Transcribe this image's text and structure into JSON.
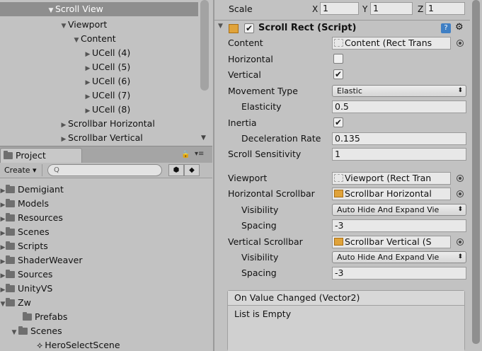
{
  "hierarchy": {
    "rows": [
      {
        "label": "Scroll View",
        "arrow": "▼",
        "selected": true
      },
      {
        "label": "Viewport",
        "arrow": "▼"
      },
      {
        "label": "Content",
        "arrow": "▼"
      },
      {
        "label": "UCell (4)",
        "arrow": "▶"
      },
      {
        "label": "UCell (5)",
        "arrow": "▶"
      },
      {
        "label": "UCell (6)",
        "arrow": "▶"
      },
      {
        "label": "UCell (7)",
        "arrow": "▶"
      },
      {
        "label": "UCell (8)",
        "arrow": "▶"
      },
      {
        "label": "Scrollbar Horizontal",
        "arrow": "▶"
      },
      {
        "label": "Scrollbar Vertical",
        "arrow": "▶"
      }
    ]
  },
  "project": {
    "tab_label": "Project",
    "create_label": "Create ▾",
    "search_placeholder": "",
    "folders": [
      {
        "label": "Demigiant",
        "arrow": "▶"
      },
      {
        "label": "Models",
        "arrow": "▶"
      },
      {
        "label": "Resources",
        "arrow": "▶"
      },
      {
        "label": "Scenes",
        "arrow": "▶"
      },
      {
        "label": "Scripts",
        "arrow": "▶"
      },
      {
        "label": "ShaderWeaver",
        "arrow": "▶"
      },
      {
        "label": "Sources",
        "arrow": "▶"
      },
      {
        "label": "UnityVS",
        "arrow": "▶"
      },
      {
        "label": "Zw",
        "arrow": "▼"
      },
      {
        "label": "Prefabs",
        "arrow": ""
      },
      {
        "label": "Scenes",
        "arrow": "▼"
      },
      {
        "label": "HeroSelectScene",
        "arrow": ""
      }
    ]
  },
  "inspector": {
    "scale": {
      "label": "Scale",
      "x_label": "X",
      "x": "1",
      "y_label": "Y",
      "y": "1",
      "z_label": "Z",
      "z": "1"
    },
    "component_title": "Scroll Rect (Script)",
    "content": {
      "label": "Content",
      "value": "Content (Rect Trans"
    },
    "horizontal": {
      "label": "Horizontal",
      "checked": false
    },
    "vertical": {
      "label": "Vertical",
      "checked": true,
      "mark": "✔"
    },
    "movement_type": {
      "label": "Movement Type",
      "value": "Elastic"
    },
    "elasticity": {
      "label": "Elasticity",
      "value": "0.5"
    },
    "inertia": {
      "label": "Inertia",
      "checked": true,
      "mark": "✔"
    },
    "deceleration_rate": {
      "label": "Deceleration Rate",
      "value": "0.135"
    },
    "scroll_sensitivity": {
      "label": "Scroll Sensitivity",
      "value": "1"
    },
    "viewport": {
      "label": "Viewport",
      "value": "Viewport (Rect Tran"
    },
    "horizontal_scrollbar": {
      "label": "Horizontal Scrollbar",
      "value": "Scrollbar Horizontal"
    },
    "h_visibility": {
      "label": "Visibility",
      "value": "Auto Hide And Expand Vie"
    },
    "h_spacing": {
      "label": "Spacing",
      "value": "-3"
    },
    "vertical_scrollbar": {
      "label": "Vertical Scrollbar",
      "value": "Scrollbar Vertical (S"
    },
    "v_visibility": {
      "label": "Visibility",
      "value": "Auto Hide And Expand Vie"
    },
    "v_spacing": {
      "label": "Spacing",
      "value": "-3"
    },
    "on_value_changed": {
      "label": "On Value Changed (Vector2)",
      "empty_text": "List is Empty"
    }
  }
}
